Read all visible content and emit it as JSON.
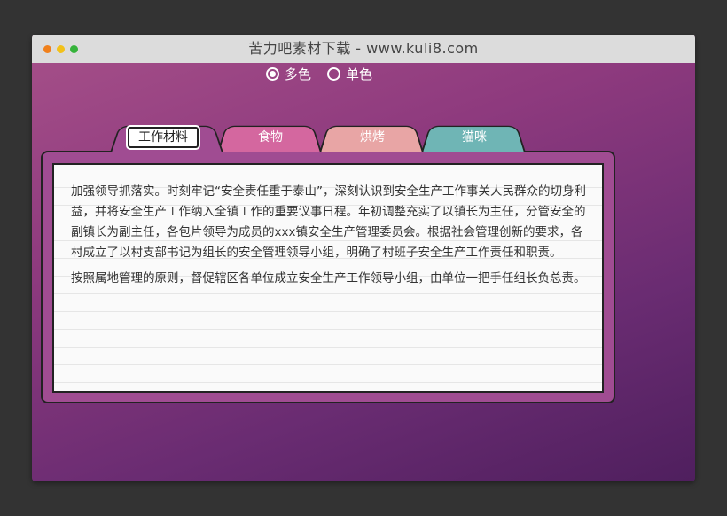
{
  "window": {
    "title": "苦力吧素材下载 - www.kuli8.com"
  },
  "color_mode": {
    "options": [
      {
        "label": "多色",
        "checked": true
      },
      {
        "label": "单色",
        "checked": false
      }
    ]
  },
  "tabs": [
    {
      "label": "工作材料",
      "active": true,
      "color": "#a04c92"
    },
    {
      "label": "食物",
      "active": false,
      "color": "#d4679f"
    },
    {
      "label": "烘烤",
      "active": false,
      "color": "#e8a5a5"
    },
    {
      "label": "猫咪",
      "active": false,
      "color": "#6fb5b5"
    }
  ],
  "content": {
    "paragraphs": [
      "加强领导抓落实。时刻牢记“安全责任重于泰山”，深刻认识到安全生产工作事关人民群众的切身利益，并将安全生产工作纳入全镇工作的重要议事日程。年初调整充实了以镇长为主任，分管安全的副镇长为副主任，各包片领导为成员的xxx镇安全生产管理委员会。根据社会管理创新的要求，各村成立了以村支部书记为组长的安全管理领导小组，明确了村班子安全生产工作责任和职责。",
      "按照属地管理的原则，督促辖区各单位成立安全生产工作领导小组，由单位一把手任组长负总责。"
    ]
  }
}
